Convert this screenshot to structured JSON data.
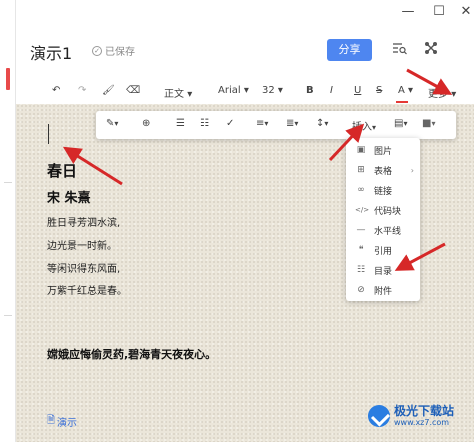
{
  "window": {
    "minimize_glyph": "—",
    "maximize_glyph": "☐",
    "close_glyph": "✕"
  },
  "header": {
    "title": "演示1",
    "saved_label": "已保存",
    "share_label": "分享",
    "icons": [
      "outline-search-icon",
      "share-graph-icon"
    ]
  },
  "toolbar": {
    "undo": "↶",
    "redo": "↷",
    "format_painter": "🖌",
    "clear_format": "⌫",
    "paragraph_style": "正文",
    "font": "Arial",
    "size": "32",
    "bold": "B",
    "italic": "I",
    "underline": "U",
    "strike": "S",
    "font_color": "A",
    "font_color_hex": "#e53935",
    "more": "更多",
    "dropdown": "▾"
  },
  "floating_bar": {
    "highlight": "✎",
    "link": "⊕",
    "bullet_list": "☰",
    "numbered_list": "☷",
    "check": "✓",
    "align": "≡",
    "indent": "≣",
    "line_height": "↕",
    "insert": "插入",
    "block": "▤",
    "color_block": "■",
    "dropdown": "▾"
  },
  "document": {
    "title": "春日",
    "author": "宋 朱熹",
    "lines": [
      "胜日寻芳泗水滨,",
      "边光景一时新。",
      "等闲识得东风面,",
      "万紫千红总是春。"
    ],
    "bold_line": "嫦娥应悔偷灵药,碧海青天夜夜心。",
    "footer_link": "演示"
  },
  "insert_menu": {
    "items": [
      {
        "icon": "▣",
        "label": "图片",
        "has_sub": false
      },
      {
        "icon": "⊞",
        "label": "表格",
        "has_sub": true
      },
      {
        "icon": "∞",
        "label": "链接",
        "has_sub": false
      },
      {
        "icon": "</>",
        "label": "代码块",
        "has_sub": false
      },
      {
        "icon": "—",
        "label": "水平线",
        "has_sub": false
      },
      {
        "icon": "❝",
        "label": "引用",
        "has_sub": false
      },
      {
        "icon": "☷",
        "label": "目录",
        "has_sub": false
      },
      {
        "icon": "⊘",
        "label": "附件",
        "has_sub": false
      }
    ],
    "sub_arrow": "›"
  },
  "watermark": {
    "name": "极光下载站",
    "url": "www.xz7.com"
  },
  "colors": {
    "accent": "#4e86f0",
    "annotation_red": "#d62828",
    "paper": "#ebe6da"
  }
}
